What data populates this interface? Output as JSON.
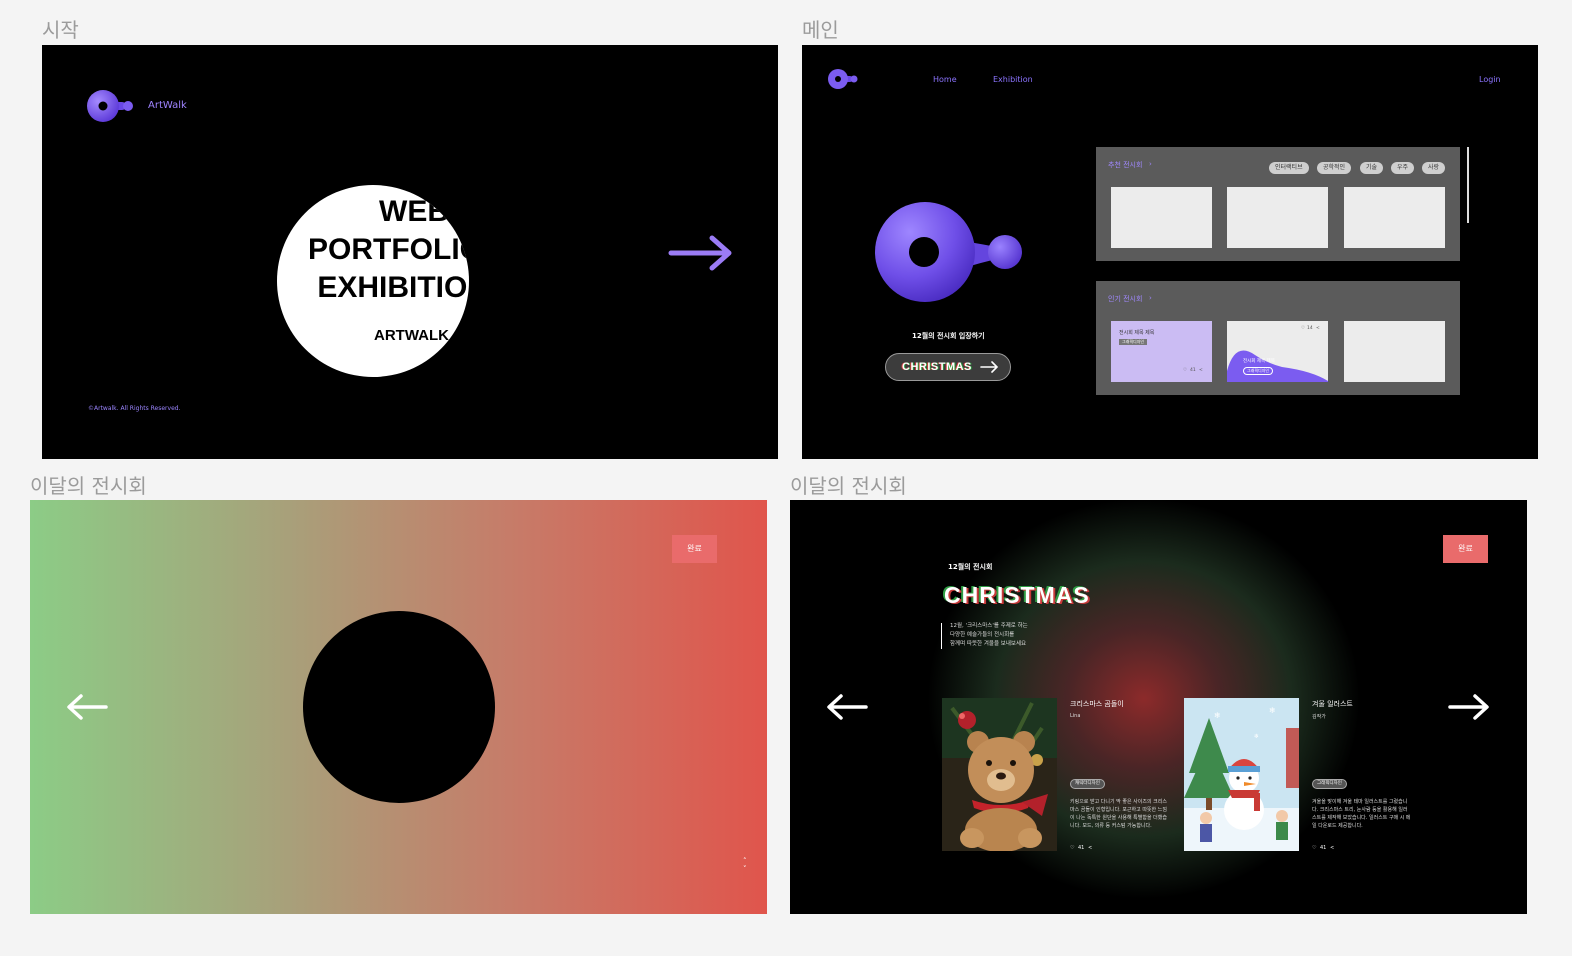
{
  "frames": {
    "start": {
      "label": "시작",
      "brand": "ArtWalk",
      "hero_lines": [
        "WEB",
        "PORTFOLIO",
        "EXHIBITION"
      ],
      "hero_sub": "ARTWALK",
      "copyright": "©Artwalk. All Rights Reserved.",
      "next_icon": "arrow-right-icon"
    },
    "main": {
      "label": "메인",
      "nav": {
        "home": "Home",
        "exhibition": "Exhibition",
        "login": "Login"
      },
      "enter_text": "12월의 전시회 입장하기",
      "cta_label": "CHRISTMAS",
      "recommended": {
        "title": "추천 전시회",
        "chips": [
          "인터랙티브",
          "공학적인",
          "기술",
          "우주",
          "사랑"
        ]
      },
      "popular": {
        "title": "인기 전시회",
        "card1": {
          "title": "전시회 제목 제목",
          "tag": "그래픽디자인",
          "likes": "41"
        },
        "card2": {
          "title": "전시회 제목 제목",
          "tag": "그래픽디자인",
          "likes": "14"
        }
      }
    },
    "month_intro": {
      "label": "이달의 전시회",
      "done_label": "완료"
    },
    "month_detail": {
      "label": "이달의 전시회",
      "done_label": "완료",
      "month_title": "12월의 전시회",
      "theme": "CHRISTMAS",
      "intro_lines": [
        "12월, '크리스마스'를 주제로 하는",
        "다양한 예술가들의 전시회를",
        "함께며 따뜻한 겨울을 보내보세요"
      ],
      "artworks": [
        {
          "title": "크리스마스 곰돌이",
          "author": "Lina",
          "tag": "캐릭터디자인",
          "desc": "키링으로 받고 다니기 딱 좋은 사이즈의 크리스마스 곰돌이 인형입니다. 포근하고 따뜻한 느낌이 나는 독특한 원단을 사용해 특별함을 더했습니다. 모드, 의류 등 커스텀 가능합니다.",
          "likes": "41"
        },
        {
          "title": "겨울 일러스트",
          "author": "김작가",
          "tag": "그래픽디자인",
          "desc": "겨울을 맞이해 겨울 테마 일러스트를 그렸습니다. 크리스마스 트리, 눈사람 등을 활용해 일러스트를 제작해 보았습니다. 일러스트 구매 시 메일 다운로드 제공합니다.",
          "likes": "41"
        }
      ]
    }
  },
  "colors": {
    "accent": "#8b6cf0",
    "done": "#e96b6b",
    "bg": "#f4f4f4"
  }
}
